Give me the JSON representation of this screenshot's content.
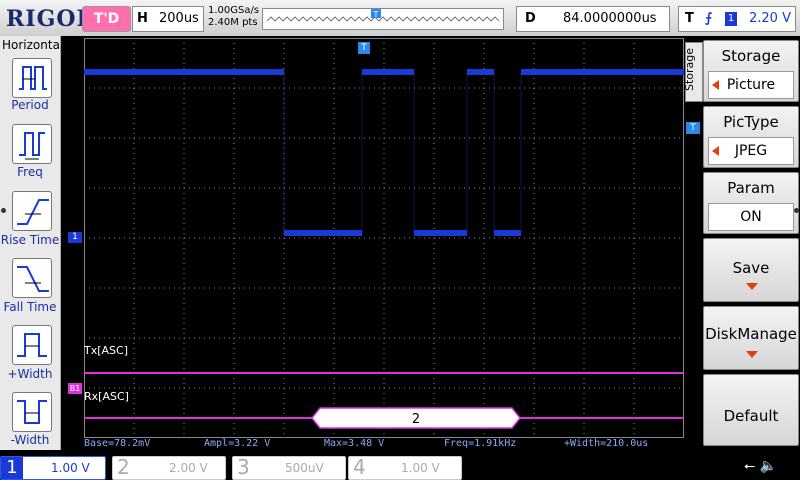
{
  "top": {
    "logo": "RIGOL",
    "run_status": "T'D",
    "horizontal_key": "H",
    "timebase": "200us",
    "sample_rate": "1.00GSa/s",
    "points": "2.40M pts",
    "delay_key": "D",
    "delay_value": "84.0000000us",
    "trigger_key": "T",
    "trigger_edge": "⨍",
    "trigger_channel": "1",
    "trigger_level": "2.20 V"
  },
  "left_menu": {
    "title": "Horizontal",
    "items": [
      {
        "label": "Period",
        "icon": "period-icon"
      },
      {
        "label": "Freq",
        "icon": "freq-icon"
      },
      {
        "label": "Rise Time",
        "icon": "rise-time-icon"
      },
      {
        "label": "Fall Time",
        "icon": "fall-time-icon"
      },
      {
        "label": "+Width",
        "icon": "pos-width-icon"
      },
      {
        "label": "-Width",
        "icon": "neg-width-icon"
      }
    ]
  },
  "right_menu": {
    "vertical_label": "Storage",
    "buttons": [
      {
        "title": "Storage",
        "value": "Picture"
      },
      {
        "title": "PicType",
        "value": "JPEG"
      },
      {
        "title": "Param",
        "value": "ON"
      },
      {
        "title": "Save"
      },
      {
        "title": "DiskManage"
      },
      {
        "title": "Default"
      }
    ]
  },
  "waveform": {
    "channel_marker": "1",
    "bus_marker": "B1",
    "tx_label": "Tx[ASC]",
    "rx_label": "Rx[ASC]",
    "decoded_value": "2",
    "trigger_marker": "T"
  },
  "measurements": {
    "base": "Base=78.2mV",
    "ampl": "Ampl=3.22 V",
    "max": "Max=3.48 V",
    "freq": "Freq=1.91kHz",
    "width": "+Width=210.0us"
  },
  "channels": [
    {
      "num": "1",
      "scale": "1.00 V",
      "color": "#2a5ae8"
    },
    {
      "num": "2",
      "scale": "2.00 V",
      "color": "#bbbbbb"
    },
    {
      "num": "3",
      "scale": "500uV",
      "color": "#bbbbbb"
    },
    {
      "num": "4",
      "scale": "1.00 V",
      "color": "#bbbbbb"
    }
  ],
  "colors": {
    "ch1": "#1a3ad8",
    "bus": "#e030e0",
    "measure": "#8fa9ff"
  }
}
